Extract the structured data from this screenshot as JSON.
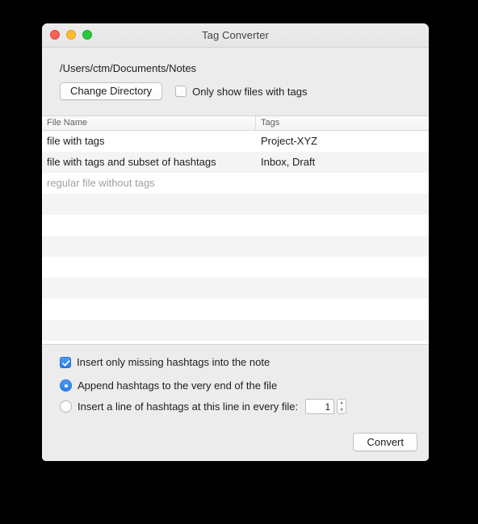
{
  "window": {
    "title": "Tag Converter",
    "traffic_lights": [
      "close-button",
      "minimize-button",
      "zoom-button"
    ]
  },
  "toolbar": {
    "directory_path": "/Users/ctm/Documents/Notes",
    "change_directory_label": "Change Directory",
    "only_show_tagged": {
      "label": "Only show files with tags",
      "checked": false
    }
  },
  "table": {
    "columns": [
      "File Name",
      "Tags"
    ],
    "rows": [
      {
        "name": "file with tags",
        "tags": "Project-XYZ",
        "untagged": false
      },
      {
        "name": "file with tags and subset of hashtags",
        "tags": "Inbox, Draft",
        "untagged": false
      },
      {
        "name": "regular file without tags",
        "tags": "",
        "untagged": true
      }
    ],
    "empty_row_count": 8
  },
  "options": {
    "insert_missing": {
      "label": "Insert only missing hashtags into the note",
      "checked": true
    },
    "mode": {
      "append_label": "Append hashtags to the very end of the file",
      "insert_line_label": "Insert a line of hashtags at this line in every file:",
      "selected": "append"
    },
    "line_number_value": "1",
    "stepper_up": "▴",
    "stepper_down": "▾"
  },
  "actions": {
    "convert_label": "Convert"
  },
  "colors": {
    "accent": "#2a7de9",
    "window_bg": "#ececec",
    "table_stripe": "#f4f4f4",
    "traffic_red": "#ff5f57",
    "traffic_yellow": "#febc2e",
    "traffic_green": "#28c840"
  }
}
